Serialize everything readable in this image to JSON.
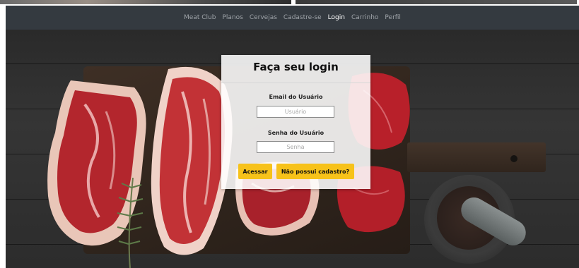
{
  "navbar": {
    "brand": "Meat Club",
    "links": [
      {
        "label": "Planos"
      },
      {
        "label": "Cervejas"
      },
      {
        "label": "Cadastre-se"
      },
      {
        "label": "Login",
        "active": true
      },
      {
        "label": "Carrinho"
      },
      {
        "label": "Perfil"
      }
    ]
  },
  "login": {
    "title": "Faça seu login",
    "email_label": "Email do Usuário",
    "email_placeholder": "Usuário",
    "password_label": "Senha do Usuário",
    "password_placeholder": "Senha",
    "submit_label": "Acessar",
    "register_label": "Não possui cadastro?"
  },
  "colors": {
    "navbar_bg": "#343a40",
    "accent_button": "#f7c21a"
  }
}
